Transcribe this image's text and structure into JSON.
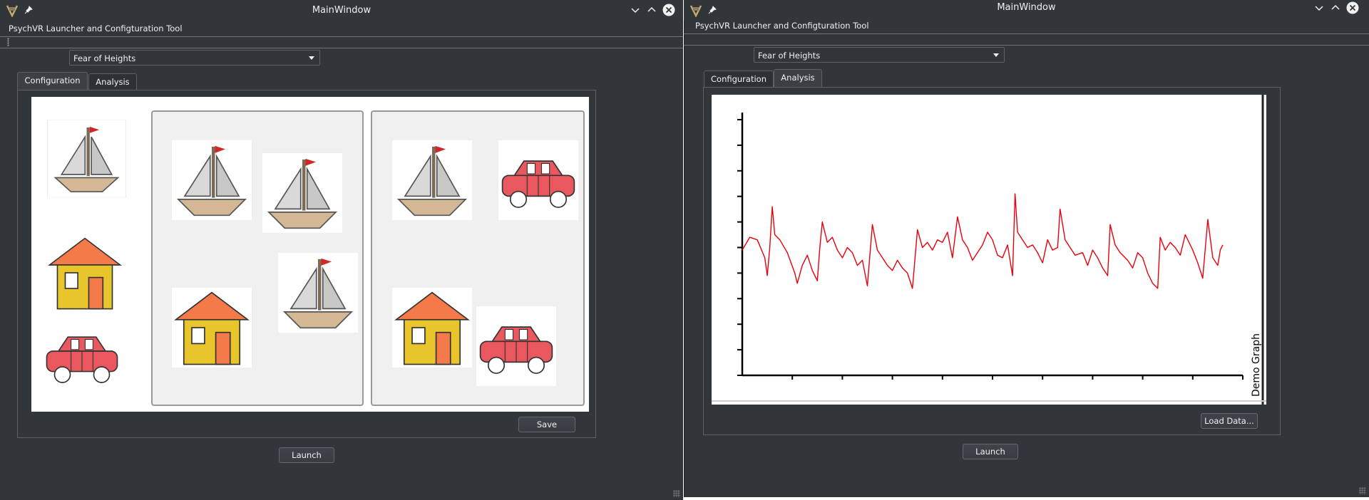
{
  "windows": {
    "config": {
      "title": "MainWindow",
      "menu_title": "PsychVR Launcher and Configturation Tool",
      "dropdown_value": "Fear of Heights",
      "tabs": [
        {
          "label": "Configuration",
          "active": true
        },
        {
          "label": "Analysis",
          "active": false
        }
      ],
      "save_label": "Save",
      "launch_label": "Launch",
      "scene": {
        "palette": [
          "sailboat-icon",
          "house-icon",
          "car-icon"
        ],
        "left_card": [
          "sailboat-icon",
          "sailboat-icon",
          "house-icon",
          "sailboat-icon"
        ],
        "right_card": [
          "sailboat-icon",
          "car-icon",
          "house-icon",
          "car-icon"
        ]
      }
    },
    "analysis": {
      "title": "MainWindow",
      "menu_title": "PsychVR Launcher and Configturation Tool",
      "dropdown_value": "Fear of Heights",
      "tabs": [
        {
          "label": "Configuration",
          "active": false
        },
        {
          "label": "Analysis",
          "active": true
        }
      ],
      "load_label": "Load Data...",
      "launch_label": "Launch"
    }
  },
  "colors": {
    "window_bg": "#31363b",
    "text": "#eff0f1",
    "signal": "#e8000b",
    "house_roof": "#f47a4a",
    "house_wall": "#e8c52a",
    "car_body": "#e9585f"
  },
  "chart_data": {
    "type": "line",
    "title": "",
    "xlabel": "",
    "ylabel": "",
    "caption": "Demo Graph",
    "x_ticks": 10,
    "y_ticks": 10,
    "ylim": [
      0,
      10
    ],
    "grid": false,
    "series": [
      {
        "color": "#e8000b",
        "points": [
          [
            0.0,
            4.9
          ],
          [
            0.15,
            5.4
          ],
          [
            0.3,
            5.3
          ],
          [
            0.45,
            4.6
          ],
          [
            0.5,
            3.9
          ],
          [
            0.55,
            5.0
          ],
          [
            0.6,
            6.6
          ],
          [
            0.65,
            5.5
          ],
          [
            0.75,
            5.3
          ],
          [
            0.9,
            4.8
          ],
          [
            1.05,
            4.0
          ],
          [
            1.1,
            3.6
          ],
          [
            1.2,
            4.3
          ],
          [
            1.3,
            4.7
          ],
          [
            1.4,
            4.1
          ],
          [
            1.5,
            3.7
          ],
          [
            1.55,
            5.0
          ],
          [
            1.6,
            6.0
          ],
          [
            1.7,
            5.2
          ],
          [
            1.8,
            5.4
          ],
          [
            1.9,
            4.9
          ],
          [
            2.0,
            4.6
          ],
          [
            2.1,
            5.0
          ],
          [
            2.2,
            4.8
          ],
          [
            2.3,
            4.3
          ],
          [
            2.4,
            4.5
          ],
          [
            2.5,
            3.5
          ],
          [
            2.6,
            5.9
          ],
          [
            2.7,
            4.9
          ],
          [
            2.8,
            4.6
          ],
          [
            2.9,
            4.3
          ],
          [
            3.0,
            4.1
          ],
          [
            3.1,
            4.5
          ],
          [
            3.2,
            4.2
          ],
          [
            3.3,
            4.0
          ],
          [
            3.4,
            3.4
          ],
          [
            3.5,
            5.7
          ],
          [
            3.6,
            5.0
          ],
          [
            3.7,
            5.2
          ],
          [
            3.8,
            4.9
          ],
          [
            3.9,
            5.3
          ],
          [
            4.0,
            5.2
          ],
          [
            4.1,
            5.6
          ],
          [
            4.2,
            4.6
          ],
          [
            4.3,
            6.2
          ],
          [
            4.4,
            5.3
          ],
          [
            4.5,
            5.0
          ],
          [
            4.6,
            4.5
          ],
          [
            4.7,
            4.8
          ],
          [
            4.8,
            5.1
          ],
          [
            4.9,
            5.6
          ],
          [
            5.0,
            5.3
          ],
          [
            5.1,
            4.7
          ],
          [
            5.2,
            4.6
          ],
          [
            5.3,
            5.1
          ],
          [
            5.4,
            3.9
          ],
          [
            5.45,
            7.1
          ],
          [
            5.5,
            5.6
          ],
          [
            5.6,
            5.3
          ],
          [
            5.7,
            5.0
          ],
          [
            5.8,
            5.1
          ],
          [
            5.9,
            4.8
          ],
          [
            6.0,
            4.4
          ],
          [
            6.1,
            5.3
          ],
          [
            6.2,
            4.9
          ],
          [
            6.3,
            5.0
          ],
          [
            6.35,
            6.5
          ],
          [
            6.45,
            5.3
          ],
          [
            6.55,
            5.0
          ],
          [
            6.65,
            4.7
          ],
          [
            6.8,
            4.8
          ],
          [
            6.9,
            4.3
          ],
          [
            7.0,
            4.9
          ],
          [
            7.1,
            4.6
          ],
          [
            7.2,
            4.2
          ],
          [
            7.3,
            3.9
          ],
          [
            7.35,
            5.9
          ],
          [
            7.45,
            5.1
          ],
          [
            7.55,
            4.8
          ],
          [
            7.7,
            4.5
          ],
          [
            7.8,
            4.2
          ],
          [
            7.9,
            4.8
          ],
          [
            8.0,
            4.6
          ],
          [
            8.1,
            4.0
          ],
          [
            8.2,
            3.6
          ],
          [
            8.3,
            3.4
          ],
          [
            8.35,
            5.4
          ],
          [
            8.45,
            4.9
          ],
          [
            8.55,
            5.2
          ],
          [
            8.65,
            5.0
          ],
          [
            8.75,
            4.7
          ],
          [
            8.85,
            5.5
          ],
          [
            9.0,
            4.9
          ],
          [
            9.1,
            4.4
          ],
          [
            9.2,
            3.8
          ],
          [
            9.3,
            6.1
          ],
          [
            9.4,
            4.6
          ],
          [
            9.5,
            4.3
          ],
          [
            9.55,
            4.9
          ],
          [
            9.6,
            5.1
          ]
        ]
      }
    ]
  }
}
